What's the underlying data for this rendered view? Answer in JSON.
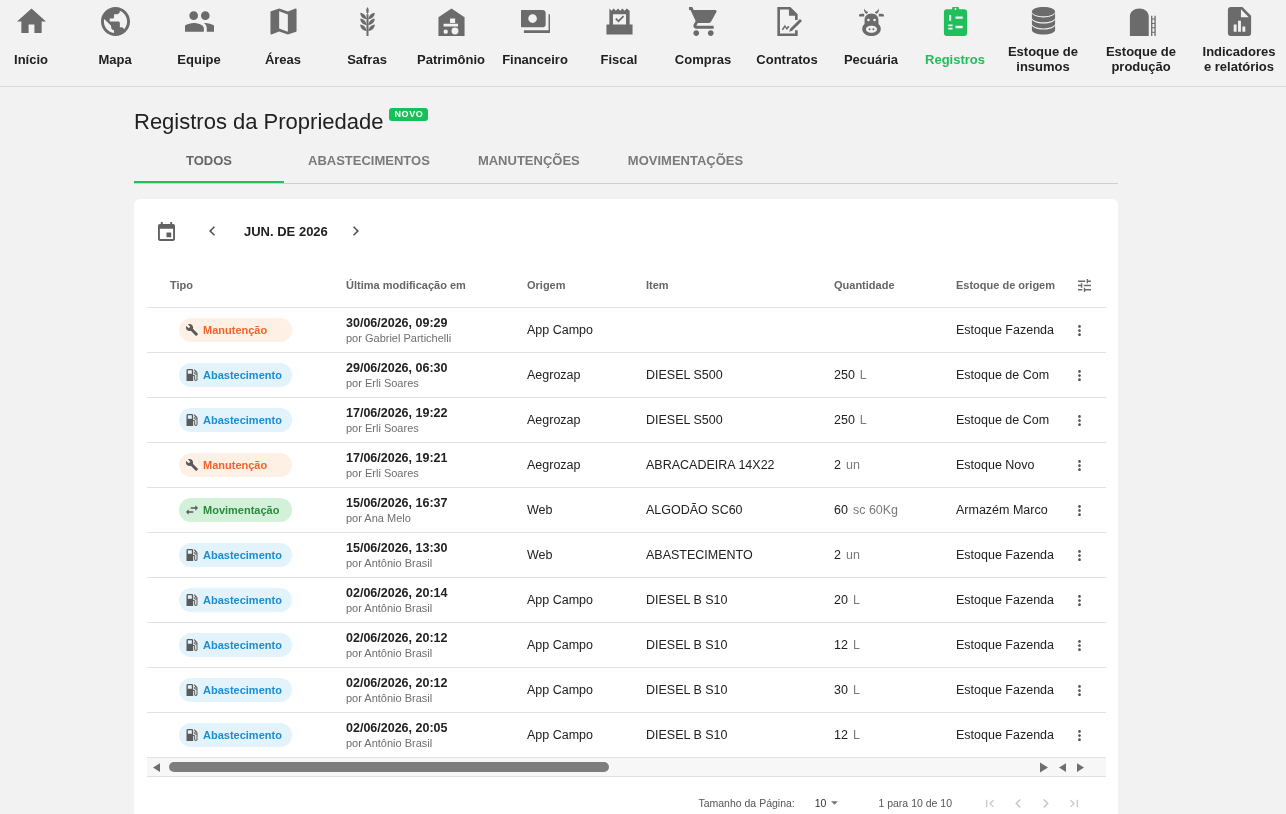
{
  "nav": {
    "items": [
      {
        "label": "Início",
        "selected": false
      },
      {
        "label": "Mapa",
        "selected": false
      },
      {
        "label": "Equipe",
        "selected": false
      },
      {
        "label": "Áreas",
        "selected": false
      },
      {
        "label": "Safras",
        "selected": false
      },
      {
        "label": "Patrimônio",
        "selected": false
      },
      {
        "label": "Financeiro",
        "selected": false
      },
      {
        "label": "Fiscal",
        "selected": false
      },
      {
        "label": "Compras",
        "selected": false
      },
      {
        "label": "Contratos",
        "selected": false
      },
      {
        "label": "Pecuária",
        "selected": false
      },
      {
        "label": "Registros",
        "selected": true
      },
      {
        "label": "Estoque de insumos",
        "selected": false
      },
      {
        "label": "Estoque de produção",
        "selected": false
      },
      {
        "label": "Indicadores e relatórios",
        "selected": false
      }
    ]
  },
  "page": {
    "title": "Registros da Propriedade",
    "badge": "NOVO"
  },
  "tabs": [
    {
      "label": "TODOS",
      "selected": true
    },
    {
      "label": "ABASTECIMENTOS",
      "selected": false
    },
    {
      "label": "MANUTENÇÕES",
      "selected": false
    },
    {
      "label": "MOVIMENTAÇÕES",
      "selected": false
    }
  ],
  "records": {
    "month": "JUN. DE 2026",
    "table": {
      "columns": [
        "Tipo",
        "Última modificação em",
        "Origem",
        "Item",
        "Quantidade",
        "Estoque de origem"
      ],
      "rows": [
        {
          "type": {
            "kind": "maintenance",
            "label": "Manutenção"
          },
          "modified": "30/06/2026, 09:29",
          "author": "por Gabriel Partichelli",
          "origin": "App Campo",
          "stock": "Estoque Fazenda"
        },
        {
          "type": {
            "kind": "fueling",
            "label": "Abastecimento"
          },
          "modified": "29/06/2026, 06:30",
          "author": "por Erli Soares",
          "origin": "Aegrozap",
          "item": "DIESEL S500",
          "quantity": {
            "amount": "250",
            "unit": "L"
          },
          "stock": "Estoque de Com"
        },
        {
          "type": {
            "kind": "fueling",
            "label": "Abastecimento"
          },
          "modified": "17/06/2026, 19:22",
          "author": "por Erli Soares",
          "origin": "Aegrozap",
          "item": "DIESEL S500",
          "quantity": {
            "amount": "250",
            "unit": "L"
          },
          "stock": "Estoque de Com"
        },
        {
          "type": {
            "kind": "maintenance",
            "label": "Manutenção"
          },
          "modified": "17/06/2026, 19:21",
          "author": "por Erli Soares",
          "origin": "Aegrozap",
          "item": "ABRACADEIRA 14X22",
          "quantity": {
            "amount": "2",
            "unit": "un"
          },
          "stock": "Estoque Novo"
        },
        {
          "type": {
            "kind": "transfer",
            "label": "Movimentação"
          },
          "modified": "15/06/2026, 16:37",
          "author": "por Ana Melo",
          "origin": "Web",
          "item": "ALGODÃO SC60",
          "quantity": {
            "amount": "60",
            "unit": "sc 60Kg"
          },
          "stock": "Armazém Marco"
        },
        {
          "type": {
            "kind": "fueling",
            "label": "Abastecimento"
          },
          "modified": "15/06/2026, 13:30",
          "author": "por Antônio Brasil",
          "origin": "Web",
          "item": "ABASTECIMENTO",
          "quantity": {
            "amount": "2",
            "unit": "un"
          },
          "stock": "Estoque Fazenda"
        },
        {
          "type": {
            "kind": "fueling",
            "label": "Abastecimento"
          },
          "modified": "02/06/2026, 20:14",
          "author": "por Antônio Brasil",
          "origin": "App Campo",
          "item": "DIESEL B S10",
          "quantity": {
            "amount": "20",
            "unit": "L"
          },
          "stock": "Estoque Fazenda"
        },
        {
          "type": {
            "kind": "fueling",
            "label": "Abastecimento"
          },
          "modified": "02/06/2026, 20:12",
          "author": "por Antônio Brasil",
          "origin": "App Campo",
          "item": "DIESEL B S10",
          "quantity": {
            "amount": "12",
            "unit": "L"
          },
          "stock": "Estoque Fazenda"
        },
        {
          "type": {
            "kind": "fueling",
            "label": "Abastecimento"
          },
          "modified": "02/06/2026, 20:12",
          "author": "por Antônio Brasil",
          "origin": "App Campo",
          "item": "DIESEL B S10",
          "quantity": {
            "amount": "30",
            "unit": "L"
          },
          "stock": "Estoque Fazenda"
        },
        {
          "type": {
            "kind": "fueling",
            "label": "Abastecimento"
          },
          "modified": "02/06/2026, 20:05",
          "author": "por Antônio Brasil",
          "origin": "App Campo",
          "item": "DIESEL B S10",
          "quantity": {
            "amount": "12",
            "unit": "L"
          },
          "stock": "Estoque Fazenda"
        }
      ]
    },
    "pagination": {
      "page_size_label": "Tamanho da Página:",
      "page_size": "10",
      "range": "1 para 10 de 10",
      "buttons": [
        {
          "kind": "first",
          "disabled": true
        },
        {
          "kind": "previous",
          "disabled": true
        },
        {
          "kind": "next",
          "disabled": true
        },
        {
          "kind": "last",
          "disabled": true
        }
      ]
    }
  }
}
